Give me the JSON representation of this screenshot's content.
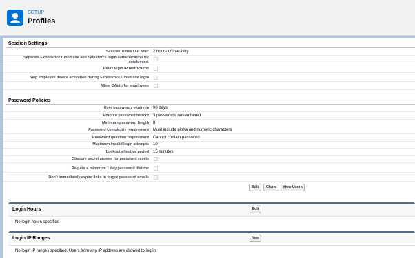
{
  "header": {
    "setup_label": "SETUP",
    "title": "Profiles",
    "icon": "user-profile-icon"
  },
  "session": {
    "title": "Session Settings",
    "rows": [
      {
        "label": "Session Times Out After",
        "value": "2 hours of inactivity"
      },
      {
        "label": "Separate Experience Cloud site and Salesforce login authentication for employees.",
        "checked": false
      },
      {
        "label": "Relax login IP restrictions",
        "checked": false
      },
      {
        "label": "Skip employee device activation during Experience Cloud site login",
        "checked": false
      },
      {
        "label": "Allow OAuth for employees",
        "checked": false
      }
    ]
  },
  "password": {
    "title": "Password Policies",
    "rows": [
      {
        "label": "User passwords expire in",
        "value": "90 days"
      },
      {
        "label": "Enforce password history",
        "value": "3 passwords remembered"
      },
      {
        "label": "Minimum password length",
        "value": "8"
      },
      {
        "label": "Password complexity requirement",
        "value": "Must include alpha and numeric characters"
      },
      {
        "label": "Password question requirement",
        "value": "Cannot contain password"
      },
      {
        "label": "Maximum invalid login attempts",
        "value": "10"
      },
      {
        "label": "Lockout effective period",
        "value": "15 minutes"
      },
      {
        "label": "Obscure secret answer for password resets",
        "checked": false
      },
      {
        "label": "Require a minimum 1 day password lifetime",
        "checked": false
      },
      {
        "label": "Don't immediately expire links in forgot password emails",
        "checked": false
      }
    ],
    "buttons": {
      "edit": "Edit",
      "clone": "Clone",
      "view_users": "View Users"
    }
  },
  "login_hours": {
    "title": "Login Hours",
    "button": "Edit",
    "empty": "No login hours specified"
  },
  "login_ip": {
    "title": "Login IP Ranges",
    "button": "New",
    "empty": "No login IP ranges specified. Users from any IP address are allowed to log in."
  }
}
